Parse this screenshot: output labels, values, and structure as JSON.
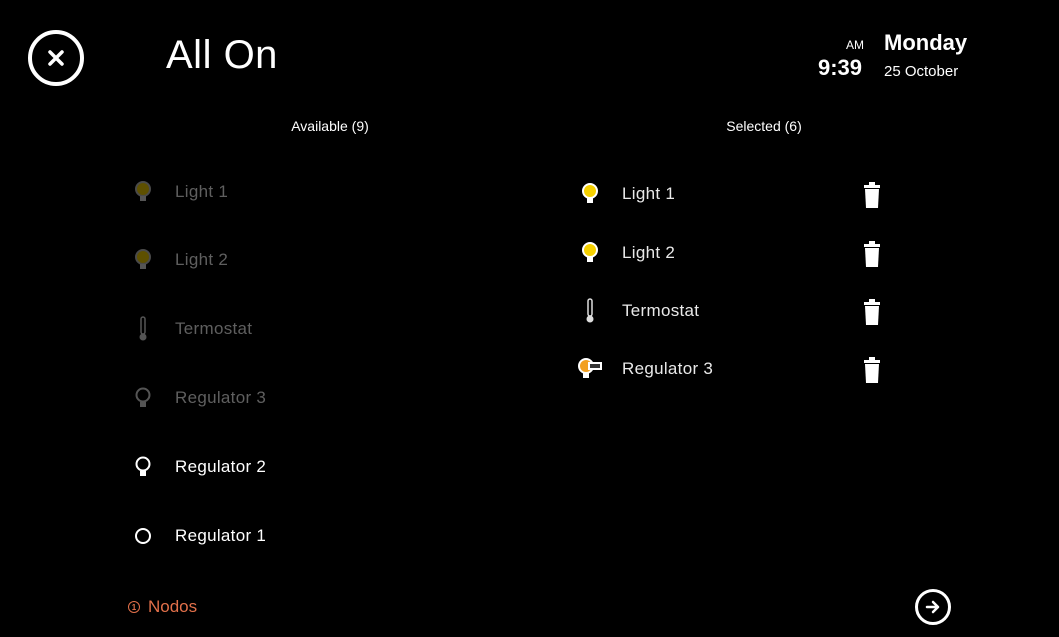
{
  "header": {
    "title": "All On",
    "ampm": "AM",
    "time": "9:39",
    "day": "Monday",
    "date": "25 October"
  },
  "available": {
    "heading": "Available (9)",
    "items": [
      {
        "label": "Light 1",
        "icon": "bulb-icon",
        "active": false
      },
      {
        "label": "Light 2",
        "icon": "bulb-icon",
        "active": false
      },
      {
        "label": "Termostat",
        "icon": "thermometer-icon",
        "active": false
      },
      {
        "label": "Regulator 3",
        "icon": "bulb-outline-icon",
        "active": false
      },
      {
        "label": "Regulator 2",
        "icon": "bulb-outline-icon",
        "active": true
      },
      {
        "label": "Regulator 1",
        "icon": "circle-icon",
        "active": true
      }
    ]
  },
  "selected": {
    "heading": "Selected (6)",
    "items": [
      {
        "label": "Light 1",
        "icon": "bulb-icon"
      },
      {
        "label": "Light 2",
        "icon": "bulb-icon"
      },
      {
        "label": "Termostat",
        "icon": "thermometer-icon"
      },
      {
        "label": "Regulator 3",
        "icon": "dimmer-bulb-icon"
      }
    ]
  },
  "footer": {
    "nodos_label": "Nodos"
  },
  "colors": {
    "background": "#000000",
    "accent": "#e2704a",
    "bulb_on": "#f5d000",
    "bulb_dim": "#6b5a00"
  }
}
